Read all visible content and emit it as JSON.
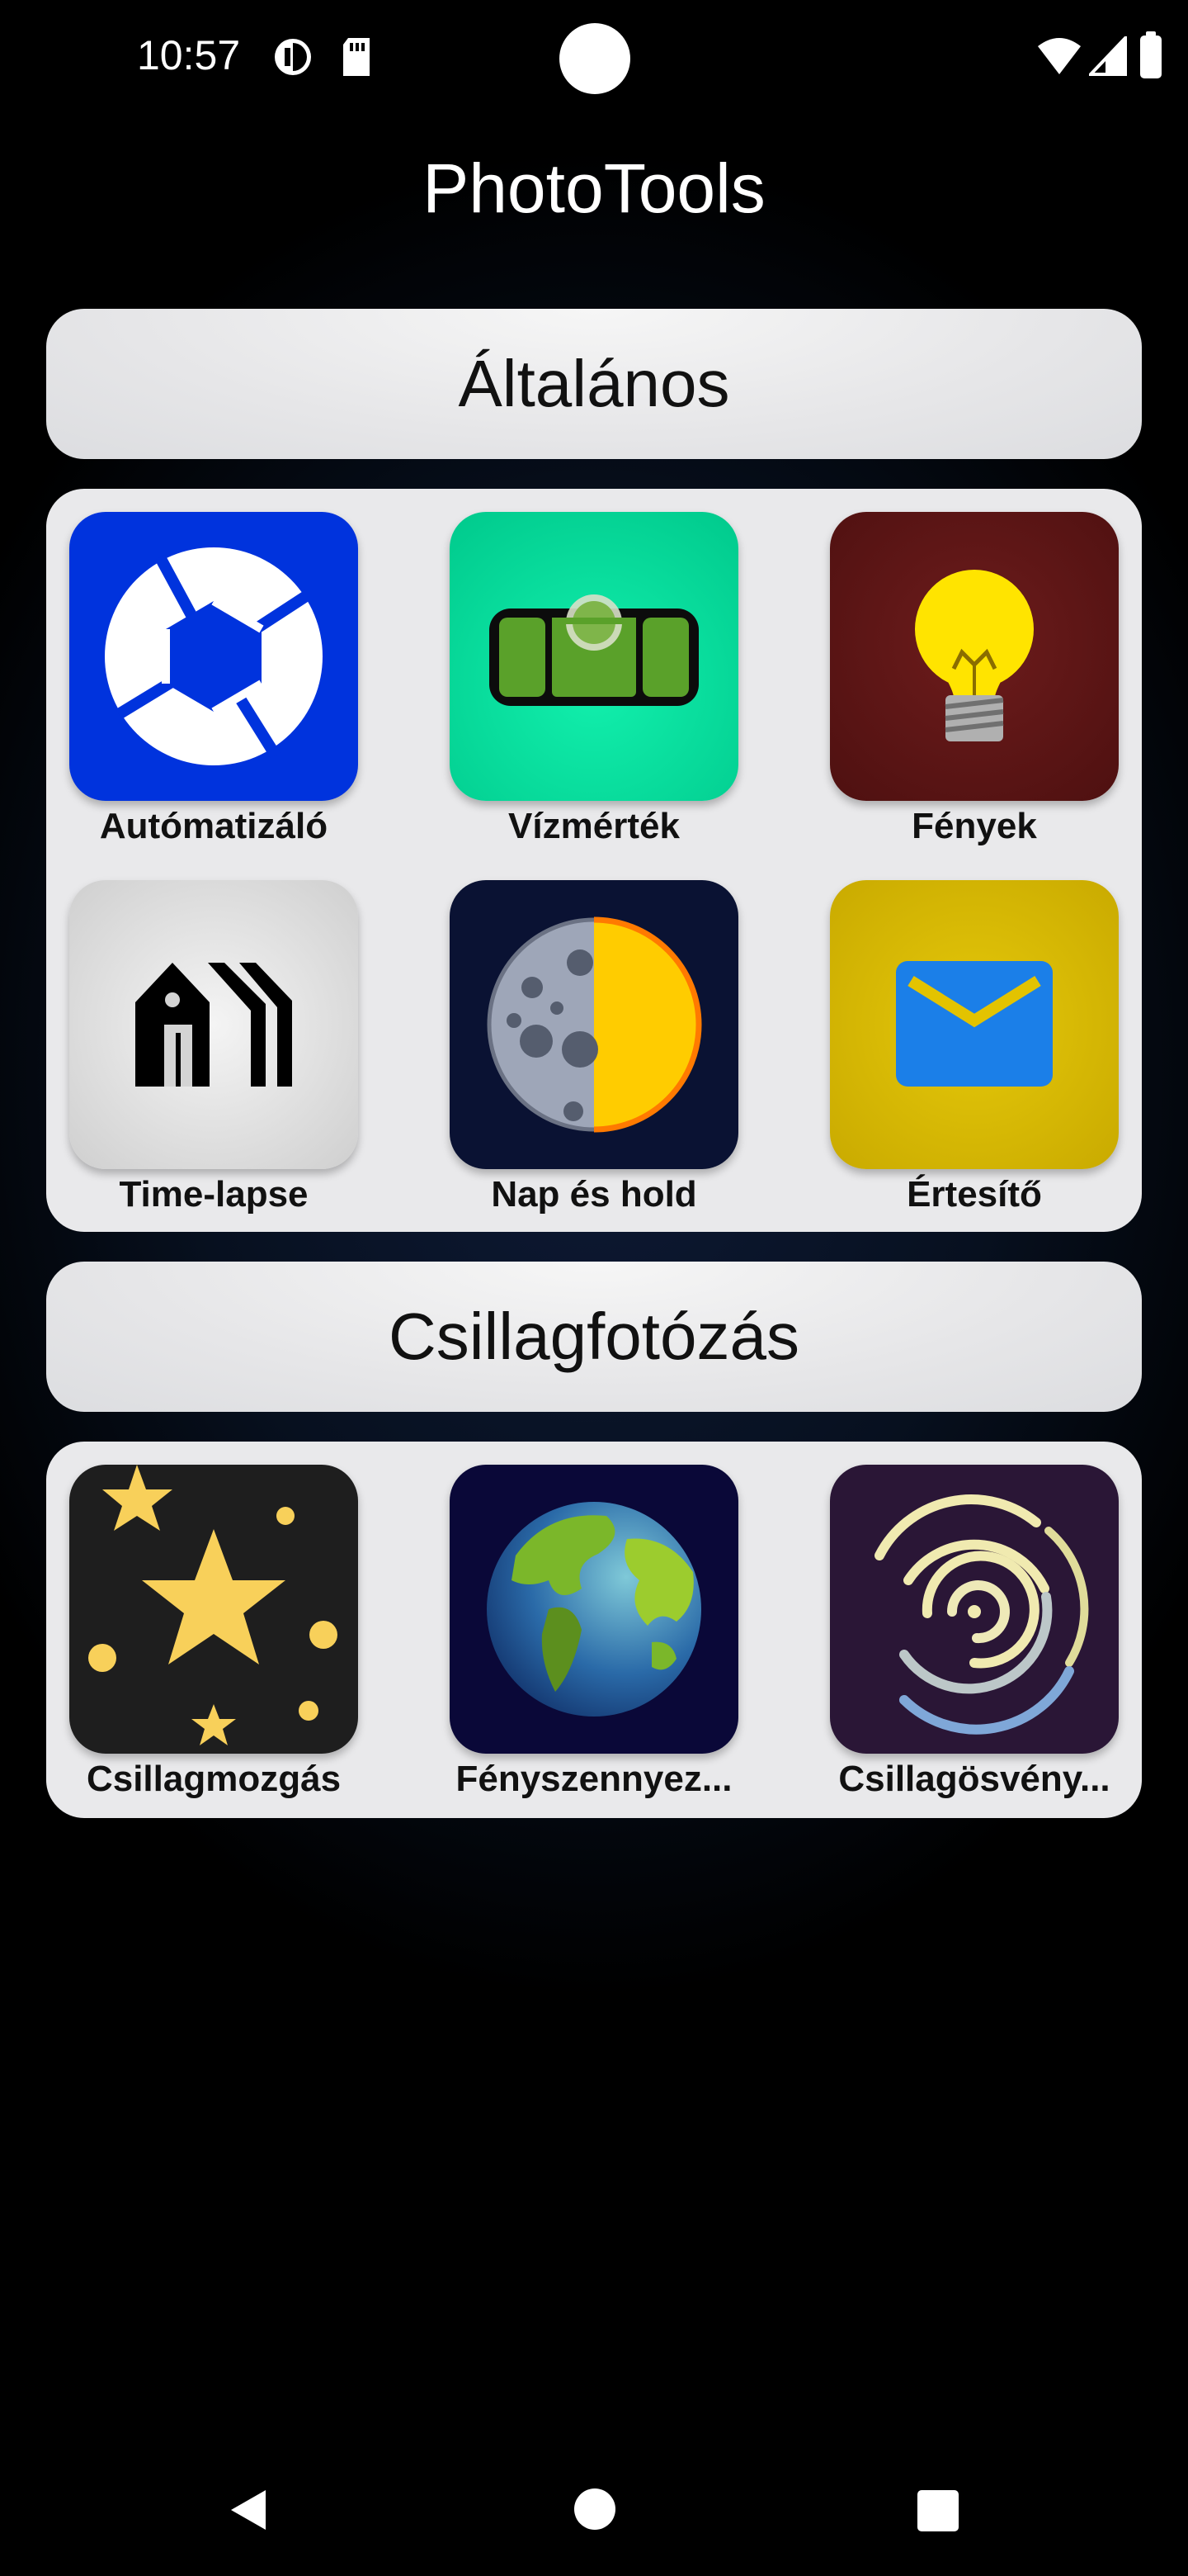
{
  "status_bar": {
    "time": "10:57"
  },
  "app": {
    "title": "PhotoTools"
  },
  "sections": [
    {
      "title": "Általános",
      "tiles": [
        {
          "label": "Autómatizáló",
          "icon": "camera-aperture-icon",
          "bg": "#0033dd"
        },
        {
          "label": "Vízmérték",
          "icon": "spirit-level-icon",
          "bg": "#00d89a"
        },
        {
          "label": "Fények",
          "icon": "lightbulb-icon",
          "bg": "#5a1212"
        },
        {
          "label": "Time-lapse",
          "icon": "time-lapse-house-icon",
          "bg": "#d4d4d4"
        },
        {
          "label": "Nap és hold",
          "icon": "sun-moon-icon",
          "bg": "#0a1233"
        },
        {
          "label": "Értesítő",
          "icon": "envelope-icon",
          "bg": "#d4b600"
        }
      ]
    },
    {
      "title": "Csillagfotózás",
      "tiles": [
        {
          "label": "Csillagmozgás",
          "icon": "stars-icon",
          "bg": "#1e1e1e"
        },
        {
          "label": "Fényszennyez...",
          "icon": "earth-icon",
          "bg": "#0a0838"
        },
        {
          "label": "Csillagösvény...",
          "icon": "star-trails-icon",
          "bg": "#2a1636"
        }
      ]
    }
  ]
}
